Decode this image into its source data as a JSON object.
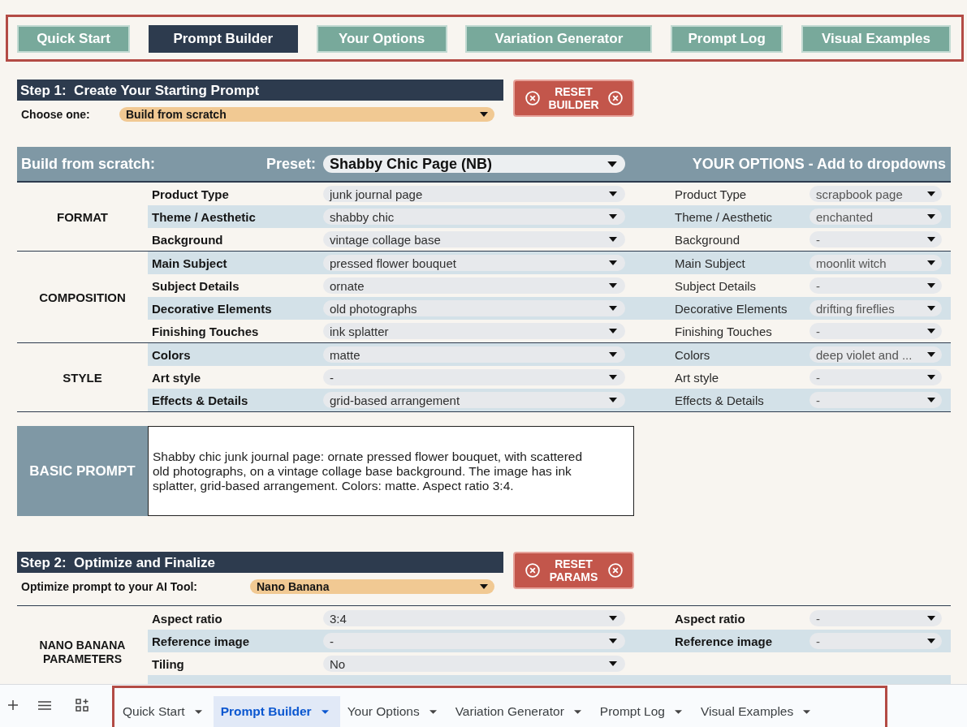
{
  "nav_tabs": [
    {
      "label": "Quick Start",
      "selected": false
    },
    {
      "label": "Prompt Builder",
      "selected": true
    },
    {
      "label": "Your Options",
      "selected": false
    },
    {
      "label": "Variation Generator",
      "selected": false
    },
    {
      "label": "Prompt Log",
      "selected": false
    },
    {
      "label": "Visual Examples",
      "selected": false
    }
  ],
  "step1": {
    "title": "Step 1:  Create Your Starting Prompt",
    "choose_label": "Choose one:",
    "choose_value": "Build from scratch",
    "reset_button": "RESET BUILDER"
  },
  "builder": {
    "title": "Build from scratch:",
    "preset_label": "Preset:",
    "preset_value": "Shabby Chic Page (NB)",
    "options_title": "YOUR OPTIONS - Add to dropdowns",
    "groups": [
      {
        "name": "FORMAT",
        "rows": [
          {
            "label": "Product Type",
            "value": "junk journal page",
            "option_label": "Product Type",
            "option_value": "scrapbook page"
          },
          {
            "label": "Theme / Aesthetic",
            "value": "shabby chic",
            "option_label": "Theme / Aesthetic",
            "option_value": "enchanted"
          },
          {
            "label": "Background",
            "value": "vintage collage base",
            "option_label": "Background",
            "option_value": "-"
          }
        ]
      },
      {
        "name": "COMPOSITION",
        "rows": [
          {
            "label": "Main Subject",
            "value": "pressed flower bouquet",
            "option_label": "Main Subject",
            "option_value": "moonlit witch"
          },
          {
            "label": "Subject Details",
            "value": "ornate",
            "option_label": "Subject Details",
            "option_value": "-"
          },
          {
            "label": "Decorative Elements",
            "value": "old photographs",
            "option_label": "Decorative Elements",
            "option_value": "drifting fireflies"
          },
          {
            "label": "Finishing Touches",
            "value": "ink splatter",
            "option_label": "Finishing Touches",
            "option_value": "-"
          }
        ]
      },
      {
        "name": "STYLE",
        "rows": [
          {
            "label": "Colors",
            "value": "matte",
            "option_label": "Colors",
            "option_value": "deep violet and ..."
          },
          {
            "label": "Art style",
            "value": "-",
            "option_label": "Art style",
            "option_value": "-"
          },
          {
            "label": "Effects & Details",
            "value": "grid-based arrangement",
            "option_label": "Effects & Details",
            "option_value": "-"
          }
        ]
      }
    ]
  },
  "basic_prompt": {
    "label": "BASIC PROMPT",
    "text": "Shabby chic junk journal page: ornate pressed flower bouquet, with scattered old photographs, on a vintage collage base background. The image has ink splatter, grid-based arrangement. Colors: matte. Aspect ratio 3:4."
  },
  "step2": {
    "title": "Step 2:  Optimize and Finalize",
    "choose_label": "Optimize prompt to your AI Tool:",
    "choose_value": "Nano Banana",
    "reset_button": "RESET PARAMS"
  },
  "parameters": {
    "group": "NANO BANANA PARAMETERS",
    "rows": [
      {
        "label": "Aspect ratio",
        "value": "3:4",
        "option_label": "Aspect ratio",
        "option_value": "-"
      },
      {
        "label": "Reference image",
        "value": "-",
        "option_label": "Reference image",
        "option_value": "-"
      },
      {
        "label": "Tiling",
        "value": "No"
      }
    ]
  },
  "sheet_tabs": [
    {
      "label": "Quick Start",
      "selected": false
    },
    {
      "label": "Prompt Builder",
      "selected": true
    },
    {
      "label": "Your Options",
      "selected": false
    },
    {
      "label": "Variation Generator",
      "selected": false
    },
    {
      "label": "Prompt Log",
      "selected": false
    },
    {
      "label": "Visual Examples",
      "selected": false
    }
  ]
}
